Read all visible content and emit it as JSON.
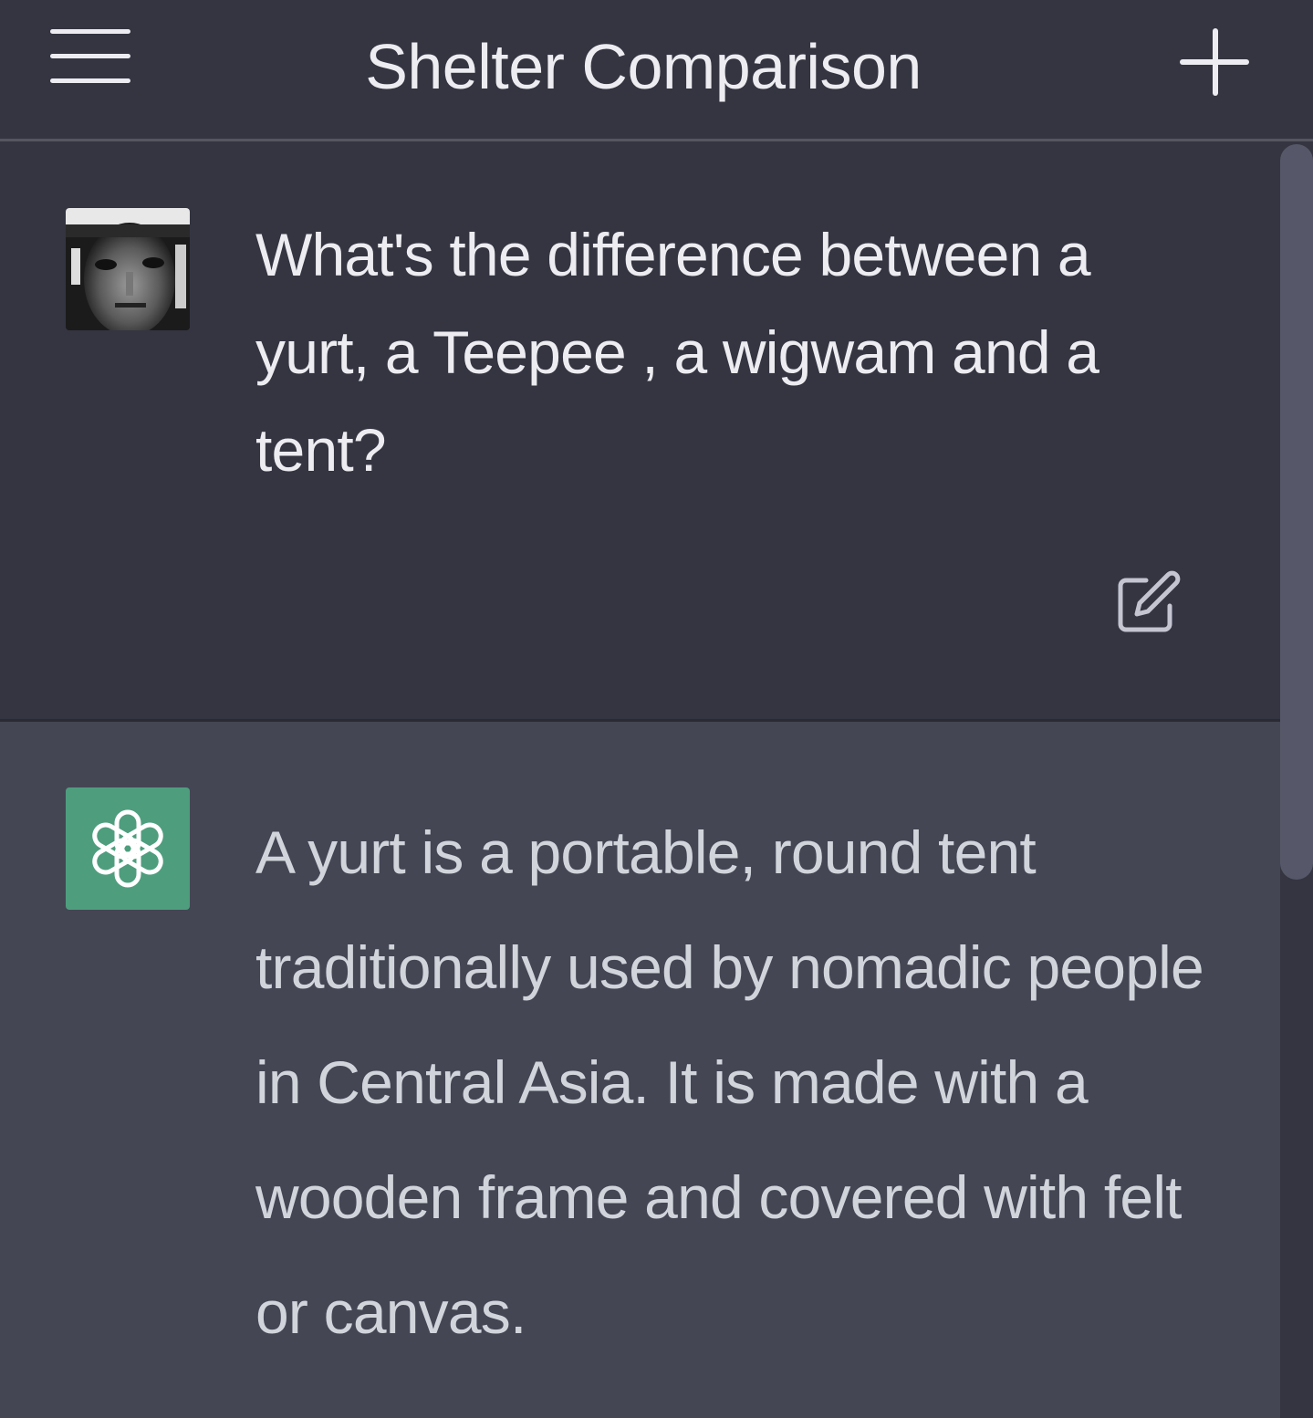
{
  "header": {
    "title": "Shelter Comparison"
  },
  "messages": {
    "user": {
      "text": "What's the difference between a yurt, a Teepee , a wigwam and a tent?"
    },
    "assistant": {
      "text": "A yurt is a portable, round tent traditionally used by nomadic people in Central Asia. It is made with a wooden frame and covered with felt or canvas."
    }
  },
  "icons": {
    "menu": "hamburger-menu-icon",
    "new_chat": "plus-icon",
    "edit": "edit-square-pencil-icon",
    "assistant_logo": "openai-logo-icon"
  },
  "colors": {
    "background": "#343541",
    "assistant_background": "#444654",
    "assistant_avatar": "#4e9e7e",
    "text": "#ececf1"
  }
}
